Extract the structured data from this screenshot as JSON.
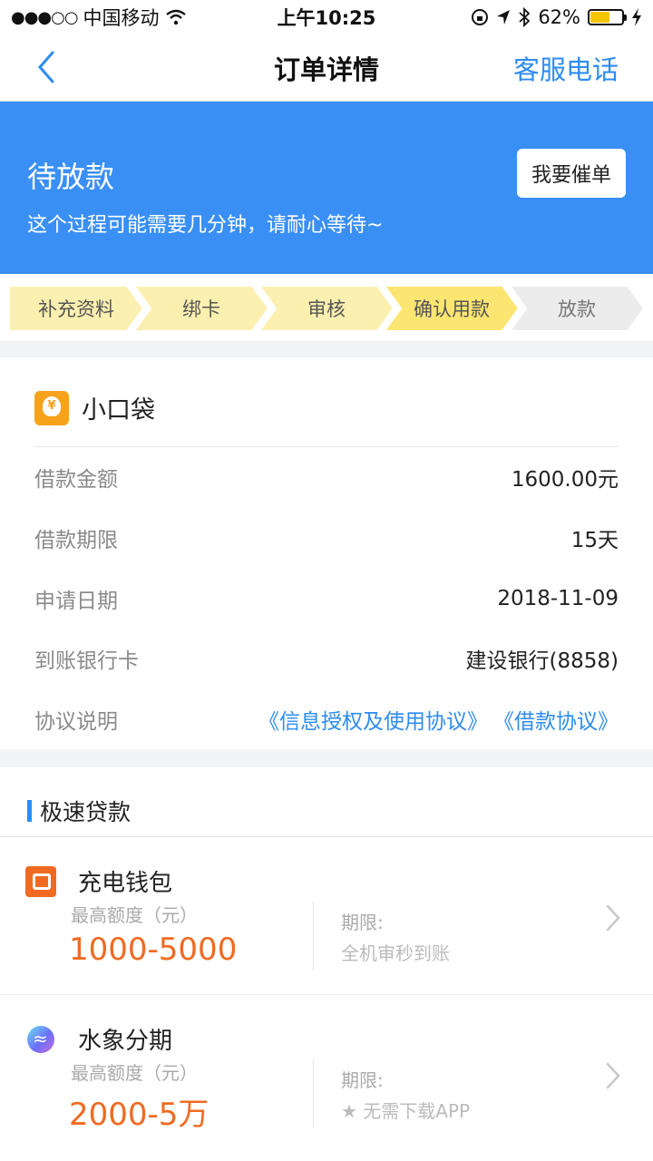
{
  "status_bar": {
    "carrier": "中国移动",
    "time": "上午10:25",
    "battery": "62%",
    "battery_level": 0.62
  },
  "nav": {
    "title": "订单详情",
    "action": "客服电话"
  },
  "hero": {
    "status": "待放款",
    "subtitle": "这个过程可能需要几分钟，请耐心等待~",
    "urge_button": "我要催单"
  },
  "steps": {
    "items": [
      {
        "label": "补充资料",
        "state": "done"
      },
      {
        "label": "绑卡",
        "state": "done"
      },
      {
        "label": "审核",
        "state": "done"
      },
      {
        "label": "确认用款",
        "state": "current"
      },
      {
        "label": "放款",
        "state": "pending"
      }
    ]
  },
  "order": {
    "brand": "小口袋",
    "rows": [
      {
        "label": "借款金额",
        "value": "1600.00元"
      },
      {
        "label": "借款期限",
        "value": "15天"
      },
      {
        "label": "申请日期",
        "value": "2018-11-09"
      },
      {
        "label": "到账银行卡",
        "value": "建设银行(8858)"
      }
    ],
    "agreement_label": "协议说明",
    "agreements": [
      "《信息授权及使用协议》",
      "《借款协议》"
    ]
  },
  "fast_loans": {
    "title": "极速贷款",
    "items": [
      {
        "name": "充电钱包",
        "amount_label": "最高额度（元）",
        "amount": "1000-5000",
        "term_label": "期限:",
        "term": "全机审秒到账"
      },
      {
        "name": "水象分期",
        "amount_label": "最高额度（元）",
        "amount": "2000-5万",
        "term_label": "期限:",
        "term": "★ 无需下载APP"
      }
    ]
  },
  "colors": {
    "primary": "#3a8ff5",
    "link": "#2d8cf0",
    "amount": "#f06a22",
    "step_done": "#fbf0b0",
    "step_current": "#fce671",
    "step_pending": "#ececec"
  }
}
